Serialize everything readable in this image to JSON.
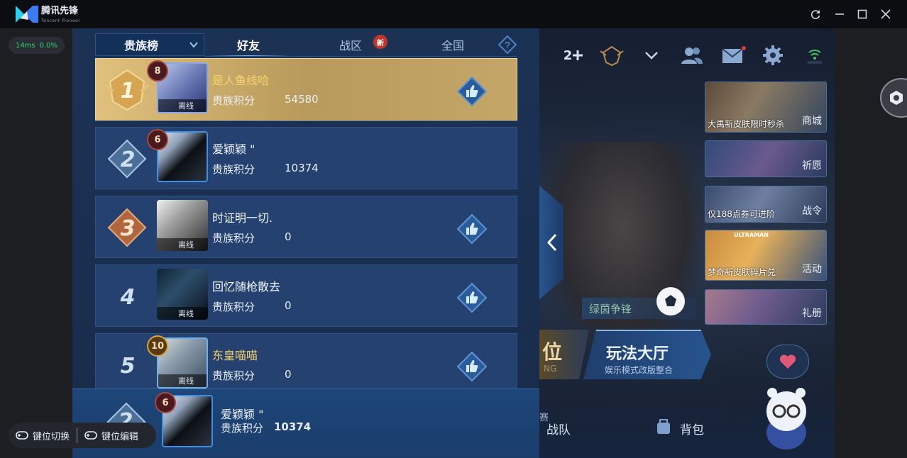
{
  "titlebar": {
    "brand": "腾讯先锋",
    "brand_sub": "Tencent Pioneer"
  },
  "ping": {
    "latency": "14ms",
    "loss": "0.0%"
  },
  "tabs": {
    "dropdown": "贵族榜",
    "friends": "好友",
    "region": "战区",
    "region_badge": "新",
    "national": "全国"
  },
  "rows": [
    {
      "rank": "1",
      "level": "8",
      "name": "是人鱼线哈",
      "label": "贵族积分",
      "score": "54580",
      "status": "离线",
      "liked": true
    },
    {
      "rank": "2",
      "level": "6",
      "name": "爱颖颖 \"",
      "label": "贵族积分",
      "score": "10374",
      "status": "",
      "liked": false
    },
    {
      "rank": "3",
      "level": "",
      "name": "时证明一切.",
      "label": "贵族积分",
      "score": "0",
      "status": "离线",
      "liked": true
    },
    {
      "rank": "4",
      "level": "",
      "name": "回忆随枪散去",
      "label": "贵族积分",
      "score": "0",
      "status": "离线",
      "liked": true
    },
    {
      "rank": "5",
      "level": "10",
      "name": "东皇喵喵",
      "label": "贵族积分",
      "score": "0",
      "status": "离线",
      "liked": true
    }
  ],
  "mine": {
    "rank": "2",
    "level": "6",
    "name": "爱颖颖 \"",
    "label": "贵族积分",
    "score": "10374"
  },
  "top_right": {
    "count": "2"
  },
  "cards": [
    {
      "caption": "大禹新皮肤限时秒杀",
      "side": "商城"
    },
    {
      "caption": "",
      "side": "祈愿"
    },
    {
      "caption": "仅188点券可进阶",
      "side": "战令"
    },
    {
      "caption": "梦奇新皮肤碎片兑",
      "side": "活动",
      "tag": "ULTRAMAN"
    },
    {
      "caption": "",
      "side": "礼册"
    }
  ],
  "lobby": {
    "event": "绿茵争锋",
    "mode_left": "位",
    "mode_left_sub": "NG",
    "mode_title": "玩法大厅",
    "mode_sub": "娱乐模式改版整合",
    "team": "战队",
    "bag": "背包",
    "match": "赛"
  },
  "keyboard": {
    "switch": "键位切换",
    "edit": "键位编辑"
  },
  "colors": {
    "accent": "#6fc2ff",
    "gold": "#e0c07c",
    "panel": "#244170"
  }
}
